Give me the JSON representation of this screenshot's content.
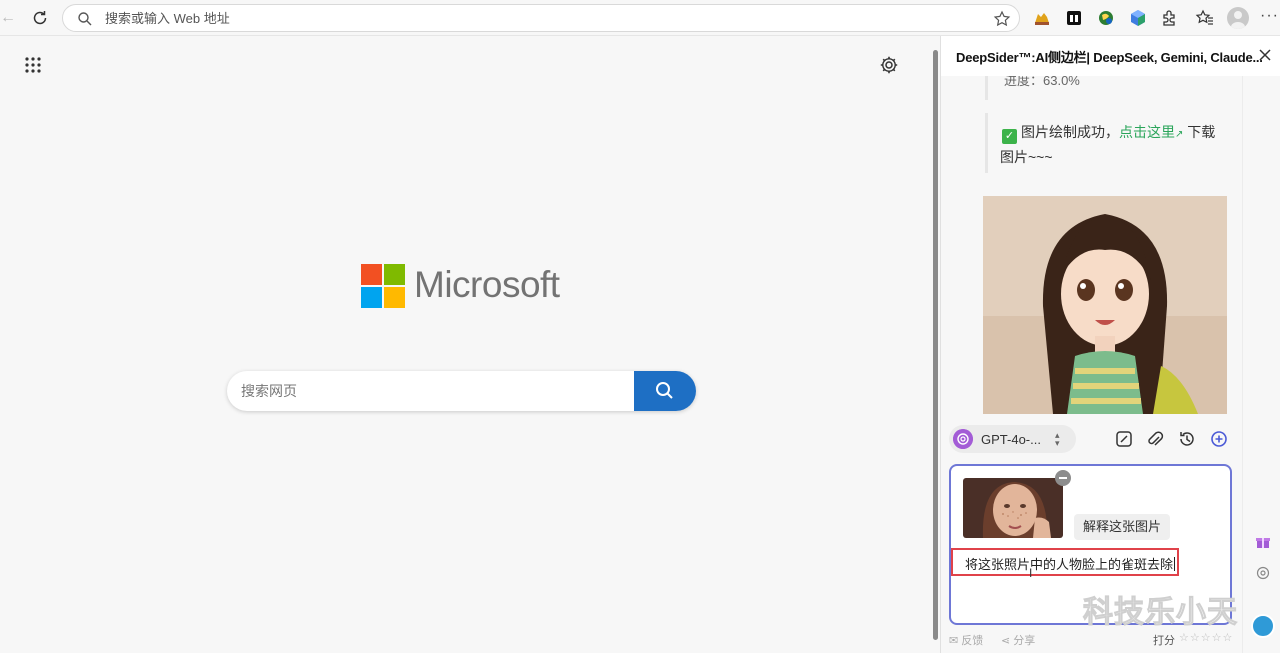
{
  "browser": {
    "address_placeholder": "搜索或输入 Web 地址"
  },
  "new_tab": {
    "brand_name": "Microsoft",
    "search_placeholder": "搜索网页"
  },
  "sidebar": {
    "title": "DeepSider™:AI侧边栏| DeepSeek, Gemini, Claude...",
    "messages": {
      "progress_text": "进度：63.0%",
      "done_prefix": "图片绘制成功，",
      "done_link": "点击这里",
      "done_suffix": "下载",
      "done_line2": "图片~~~"
    },
    "model": {
      "name": "GPT-4o-..."
    },
    "composer": {
      "suggestion_chip": "解释这张图片",
      "prompt_text": "将这张照片中的人物脸上的雀斑去除"
    },
    "footer": {
      "feedback": "反馈",
      "share": "分享",
      "rate": "打分",
      "stars": "☆☆☆☆☆"
    }
  },
  "watermark": "科技乐小天",
  "colors": {
    "search_button": "#1e6fc4",
    "composer_border": "#6e77d6",
    "prompt_highlight": "#e0424a",
    "link_green": "#2aa55a"
  }
}
